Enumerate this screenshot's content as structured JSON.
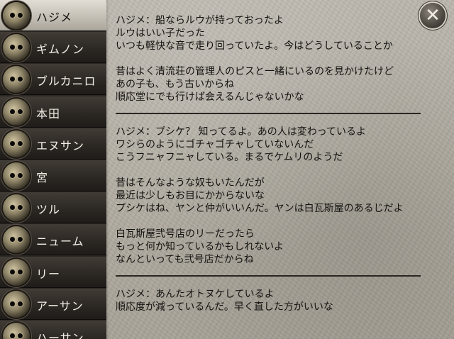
{
  "characters": [
    {
      "name": "ハジメ",
      "selected": true
    },
    {
      "name": "ギムノン",
      "selected": false
    },
    {
      "name": "ブルカニロ",
      "selected": false
    },
    {
      "name": "本田",
      "selected": false
    },
    {
      "name": "エヌサン",
      "selected": false
    },
    {
      "name": "宮",
      "selected": false
    },
    {
      "name": "ツル",
      "selected": false
    },
    {
      "name": "ニューム",
      "selected": false
    },
    {
      "name": "リー",
      "selected": false
    },
    {
      "name": "アーサン",
      "selected": false
    },
    {
      "name": "ハーサン",
      "selected": false
    }
  ],
  "dialog": [
    {
      "paragraphs": [
        [
          "ハジメ：船ならルウが持っておったよ",
          "ルウはいい子だった",
          "いつも軽快な音で走り回っていたよ。今はどうしていることか"
        ],
        [
          "昔はよく清流荘の管理人のピスと一緒にいるのを見かけたけど",
          "あの子も、もう古いからね",
          "順応堂にでも行けば会えるんじゃないかな"
        ]
      ]
    },
    {
      "paragraphs": [
        [
          "ハジメ：プシケ？ 知ってるよ。あの人は変わっているよ",
          "ワシらのようにゴチャゴチャしていないんだ",
          "こうフニャフニャしている。まるでケムリのようだ"
        ],
        [
          "昔はそんなような奴もいたんだが",
          "最近は少しもお目にかからないな",
          "プシケはね、ヤンと仲がいいんだ。ヤンは白瓦斯屋のあるじだよ"
        ],
        [
          "白瓦斯屋弐号店のリーだったら",
          "もっと何か知っているかもしれないよ",
          "なんといっても弐号店だからね"
        ]
      ]
    },
    {
      "paragraphs": [
        [
          "ハジメ：あんたオトヌケしているよ",
          "順応度が減っているんだ。早く直した方がいいな"
        ]
      ]
    }
  ],
  "close_icon": "close-icon",
  "close_glyph": "✕"
}
